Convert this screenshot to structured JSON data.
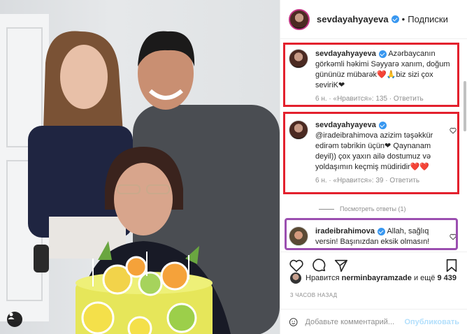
{
  "post": {
    "username": "sevdayahyayeva",
    "follow_label": "Подписки",
    "dot": "•"
  },
  "comments": [
    {
      "username": "sevdayahyayeva",
      "text": "Azərbaycanın görkəmli həkimi Səyyarə xanım, doğum gününüz mübarək❤️🙏biz sizi çox seviriK❤",
      "meta": "6 н. · «Нравится»: 135 · Ответить"
    },
    {
      "username": "sevdayahyayeva",
      "text": "@iradeibrahimova azizim təşəkkür edirəm təbrikin üçün❤ Qaynanam deyil)) çox yaxın ailə dostumuz və yoldaşımın keçmiş müdiridir❤️❤️",
      "meta": "6 н. · «Нравится»: 39 · Ответить"
    },
    {
      "username": "iradeibrahimova",
      "text": "Allah, sağlıq versin! Başınızdan eksik olmasın!",
      "meta": ""
    }
  ],
  "view_replies": "Посмотреть ответы (1)",
  "likes": {
    "prefix": "Нравится",
    "user": "nerminbayramzade",
    "suffix": "и ещё",
    "count": "9 439"
  },
  "time_ago": "3 ЧАСОВ НАЗАД",
  "add_comment": {
    "placeholder": "Добавьте комментарий...",
    "publish_label": "Опубликовать"
  },
  "colors": {
    "highlight_red": "#e3202d",
    "highlight_purple": "#9b4fb0",
    "verified_blue": "#3897f0",
    "publish_disabled": "#b2dffc"
  }
}
